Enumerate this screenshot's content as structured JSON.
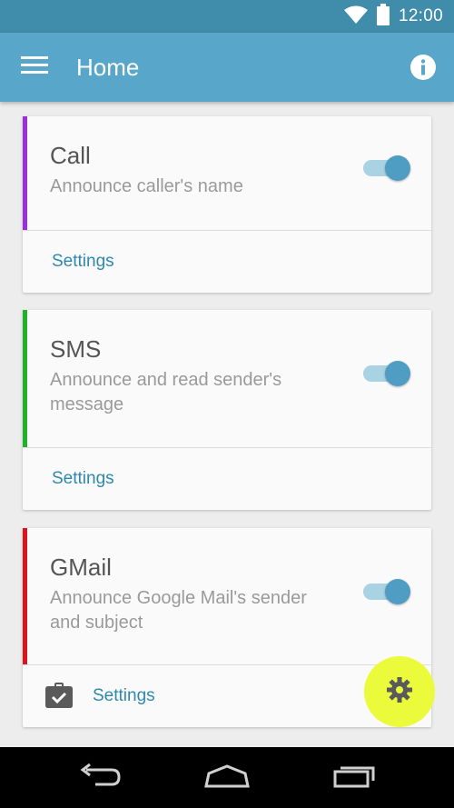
{
  "status_bar": {
    "time": "12:00",
    "icons": [
      "wifi-icon",
      "battery-icon"
    ]
  },
  "app_bar": {
    "title": "Home",
    "menu_icon": "menu-icon",
    "info_icon": "info-icon"
  },
  "colors": {
    "status_bar": "#3f8cab",
    "app_bar": "#58a6c9",
    "accent": "#4f9dc2",
    "link": "#2f88ae",
    "fab": "#ecfa3c"
  },
  "cards": [
    {
      "title": "Call",
      "description": "Announce caller's name",
      "accent_color": "#9b30d9",
      "enabled": true,
      "settings_label": "Settings"
    },
    {
      "title": "SMS",
      "description": "Announce and read sender's message",
      "accent_color": "#22b12a",
      "enabled": true,
      "settings_label": "Settings"
    },
    {
      "title": "GMail",
      "description": "Announce Google Mail's sender and subject",
      "accent_color": "#d9141b",
      "enabled": true,
      "settings_label": "Settings",
      "settings_icon": "briefcase-check-icon"
    }
  ],
  "fab": {
    "icon": "gear-icon"
  },
  "nav_bar": {
    "icons": [
      "back-icon",
      "home-icon",
      "recents-icon"
    ]
  }
}
